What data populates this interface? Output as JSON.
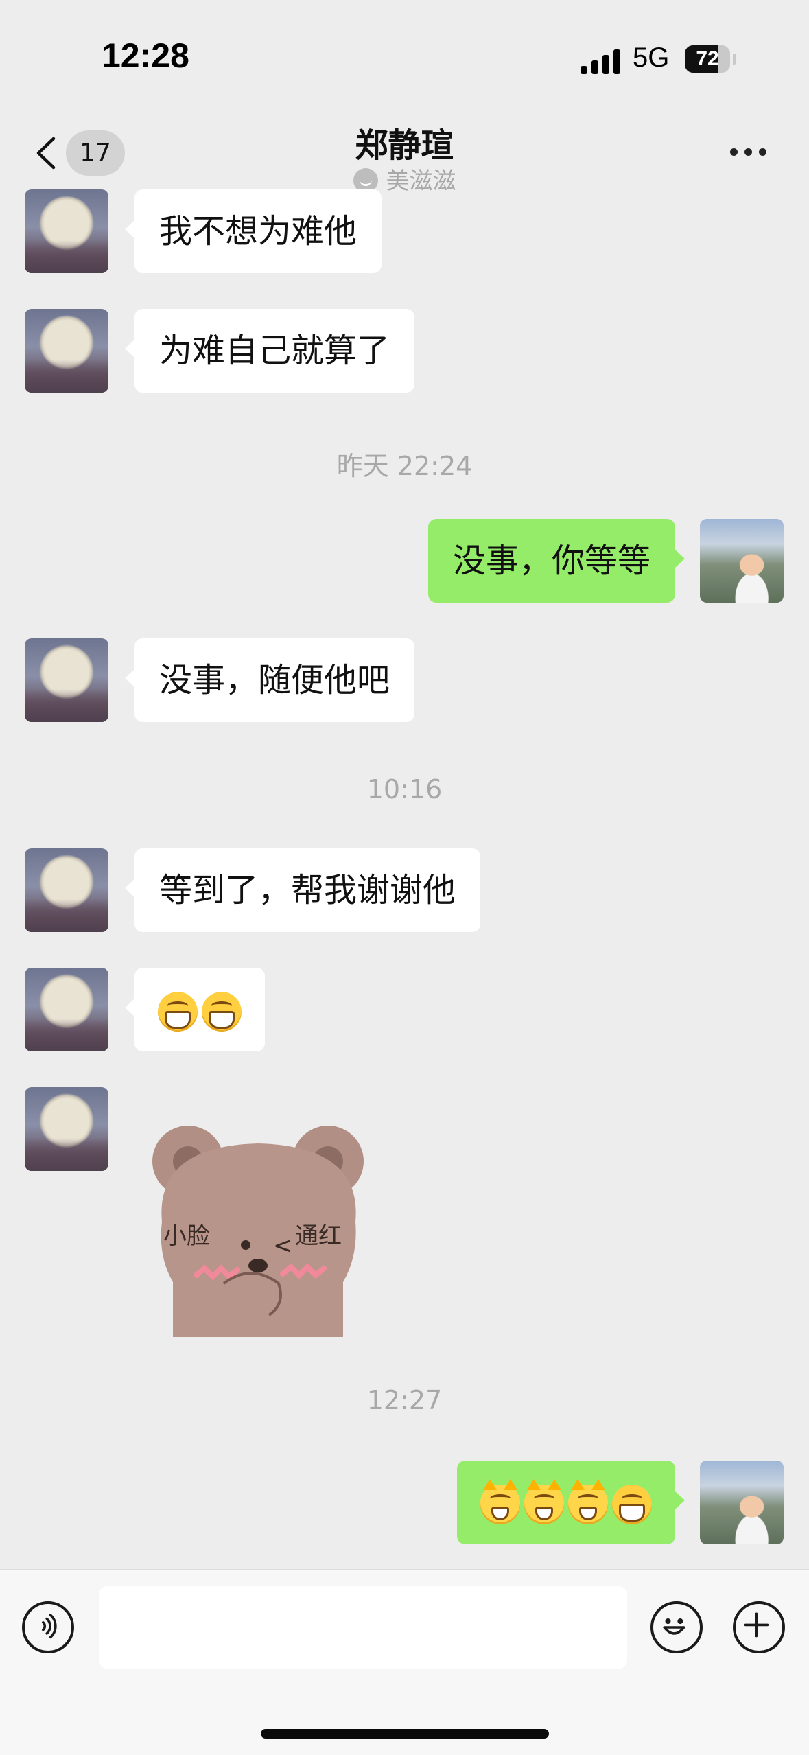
{
  "status_bar": {
    "time": "12:28",
    "network": "5G",
    "battery": "72",
    "battery_level": 0.72
  },
  "nav": {
    "unread_count": "17",
    "title": "郑静瑄",
    "subtitle": "美滋滋"
  },
  "messages": [
    {
      "text": "我不想为难他"
    },
    {
      "text": "为难自己就算了"
    },
    {
      "time": "昨天 22:24"
    },
    {
      "text": "没事，你等等"
    },
    {
      "text": "没事，随便他吧"
    },
    {
      "time": "10:16"
    },
    {
      "text": "等到了，帮我谢谢他"
    },
    {
      "emojis": [
        "grin-emoji",
        "grin-emoji"
      ]
    },
    {
      "sticker_text_left": "小脸",
      "sticker_text_right": "通红",
      "sticker_mark": "<"
    },
    {
      "time": "12:27"
    },
    {
      "emojis": [
        "cat-face-emoji",
        "cat-face-emoji",
        "cat-face-emoji",
        "grin-emoji"
      ]
    }
  ],
  "icons": [
    "back-icon",
    "more-icon",
    "voice-icon",
    "emoji-icon",
    "plus-icon"
  ],
  "colors": {
    "outgoing_bubble": "#95ec69",
    "incoming_bubble": "#ffffff",
    "background": "#ededed"
  }
}
